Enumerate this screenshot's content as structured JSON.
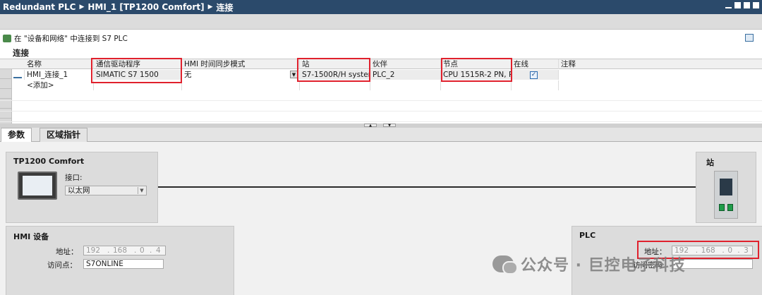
{
  "titlebar": {
    "crumbs": [
      "Redundant PLC",
      "HMI_1 [TP1200 Comfort]",
      "连接"
    ],
    "separator": "▶"
  },
  "infobar": {
    "text": "在 \"设备和网络\" 中连接到 S7 PLC"
  },
  "section_title": "连接",
  "table": {
    "columns": [
      "名称",
      "通信驱动程序",
      "HMI 时间同步模式",
      "站",
      "伙伴",
      "节点",
      "在线",
      "注释"
    ],
    "rows": [
      {
        "name": "HMI_连接_1",
        "driver": "SIMATIC S7 1500",
        "time_sync": "无",
        "station": "S7-1500R/H system...",
        "partner": "PLC_2",
        "node": "CPU 1515R-2 PN, P...",
        "online_checked": true,
        "comment": ""
      }
    ],
    "add_row_label": "<添加>"
  },
  "tabs": [
    "参数",
    "区域指针"
  ],
  "params": {
    "hmi_panel": {
      "title": "TP1200 Comfort",
      "interface_label": "接口:",
      "interface_value": "以太网"
    },
    "station_panel": {
      "title": "站"
    },
    "hmi_device_panel": {
      "title": "HMI 设备",
      "address_label": "地址：",
      "address": [
        "192",
        "168",
        "0",
        "4"
      ],
      "access_point_label": "访问点：",
      "access_point": "S7ONLINE"
    },
    "plc_panel": {
      "title": "PLC",
      "address_label": "地址：",
      "address": [
        "192",
        "168",
        "0",
        "3"
      ],
      "password_label": "访问密码"
    }
  },
  "watermark": "公众号 · 巨控电子科技",
  "colors": {
    "titlebar_bg": "#2b4a6b",
    "highlight_red": "#e0212d",
    "panel_bg": "#dcdcdc"
  }
}
